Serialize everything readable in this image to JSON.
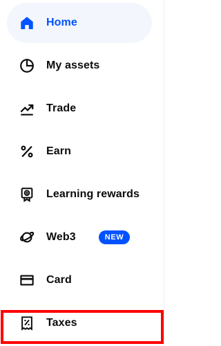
{
  "nav": {
    "items": [
      {
        "label": "Home",
        "icon": "home-icon",
        "active": true
      },
      {
        "label": "My assets",
        "icon": "pie-chart-icon"
      },
      {
        "label": "Trade",
        "icon": "trend-chart-icon"
      },
      {
        "label": "Earn",
        "icon": "percent-icon"
      },
      {
        "label": "Learning rewards",
        "icon": "reward-badge-icon"
      },
      {
        "label": "Web3",
        "icon": "planet-icon",
        "badge": "NEW"
      },
      {
        "label": "Card",
        "icon": "card-icon"
      },
      {
        "label": "Taxes",
        "icon": "tax-receipt-icon"
      }
    ]
  },
  "colors": {
    "accent": "#0052ff",
    "active_background": "#f3f6fc",
    "text": "#0a0b0d",
    "highlight": "#ff0000"
  }
}
